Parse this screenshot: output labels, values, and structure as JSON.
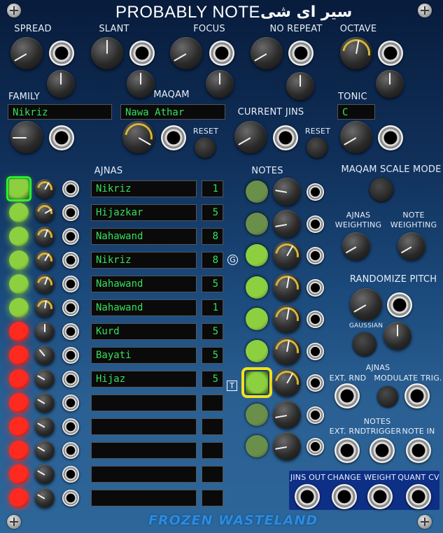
{
  "module": {
    "title": "PROBABLY NOTE",
    "title_arabic": "سیر ای شی",
    "brand": "FROZEN WASTELAND"
  },
  "top_controls": {
    "spread": "SPREAD",
    "slant": "SLANT",
    "focus": "FOCUS",
    "no_repeat": "NO REPEAT",
    "octave": "OCTAVE"
  },
  "family": {
    "label": "FAMILY",
    "value": "Nikriz"
  },
  "maqam": {
    "label": "MAQAM",
    "value": "Nawa Athar",
    "reset": "RESET"
  },
  "current_jins": {
    "label": "CURRENT JINS",
    "reset": "RESET"
  },
  "tonic": {
    "label": "TONIC",
    "value": "C"
  },
  "ajnas": {
    "heading": "AJNAS",
    "rows": [
      {
        "name": "Nikriz",
        "value": "1"
      },
      {
        "name": "Hijazkar",
        "value": "5"
      },
      {
        "name": "Nahawand",
        "value": "8"
      },
      {
        "name": "Nikriz",
        "value": "8"
      },
      {
        "name": "Nahawand",
        "value": "5"
      },
      {
        "name": "Nahawand",
        "value": "1"
      },
      {
        "name": "Kurd",
        "value": "5"
      },
      {
        "name": "Bayati",
        "value": "5"
      },
      {
        "name": "Hijaz",
        "value": "5"
      },
      {
        "name": "",
        "value": ""
      },
      {
        "name": "",
        "value": ""
      },
      {
        "name": "",
        "value": ""
      },
      {
        "name": "",
        "value": ""
      },
      {
        "name": "",
        "value": ""
      }
    ],
    "marker_g": "G"
  },
  "notes": {
    "heading": "NOTES",
    "marker_t": "T"
  },
  "right": {
    "scale_mode": "MAQAM SCALE MODE",
    "ajnas_weighting": [
      "AJNAS",
      "WEIGHTING"
    ],
    "note_weighting": [
      "NOTE",
      "WEIGHTING"
    ],
    "randomize_pitch": "RANDOMIZE PITCH",
    "gaussian": "GAUSSIAN",
    "ajnas_section": "AJNAS",
    "ext_rnd": "EXT. RND",
    "modulate_trig": "MODULATE TRIG.",
    "notes_section": "NOTES",
    "notes_ext_rnd": "EXT. RND",
    "trigger": "TRIGGER",
    "note_in": "NOTE IN"
  },
  "outputs": {
    "jins_out": "JINS OUT",
    "change": "CHANGE",
    "weight": "WEIGHT",
    "quant_cv": "QUANT CV"
  },
  "colors": {
    "led_green": "#8ccf3f",
    "led_red": "#ff2a1f",
    "display_text": "#35e05a",
    "highlight": "#f4e11a",
    "brand": "#2b8ce0"
  }
}
